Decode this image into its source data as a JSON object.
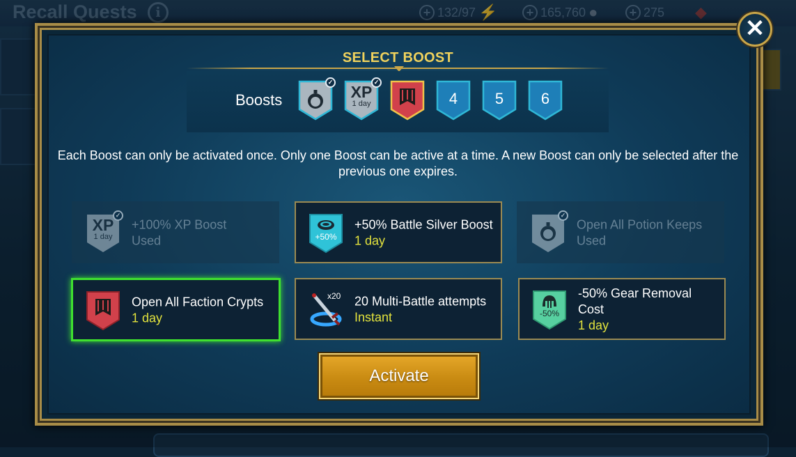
{
  "background": {
    "title": "Recall Quests",
    "info_icon": "i",
    "resources": [
      {
        "icon": "energy-icon",
        "value": "132/97"
      },
      {
        "icon": "silver-icon",
        "value": "165,760"
      },
      {
        "icon": "gem-icon",
        "value": "275"
      }
    ]
  },
  "dialog": {
    "close_glyph": "✕",
    "select_title": "SELECT BOOST",
    "boosts_label": "Boosts",
    "slots": [
      {
        "kind": "potion",
        "used": true
      },
      {
        "kind": "xp",
        "label": "XP",
        "sub": "1 day",
        "used": true
      },
      {
        "kind": "faction",
        "selected": true
      },
      {
        "kind": "empty",
        "label": "4"
      },
      {
        "kind": "empty",
        "label": "5"
      },
      {
        "kind": "empty",
        "label": "6"
      }
    ],
    "description": "Each Boost can only be activated once. Only one Boost can be active at a time. A new Boost can only be selected after the previous one expires.",
    "cards": [
      {
        "name": "+100% XP Boost",
        "sub": "Used",
        "icon_label": "XP",
        "icon_sub": "1 day",
        "state": "used"
      },
      {
        "name": "+50% Battle Silver Boost",
        "sub": "1 day",
        "icon_label": "+50%",
        "state": "available"
      },
      {
        "name": "Open All Potion Keeps",
        "sub": "Used",
        "state": "used"
      },
      {
        "name": "Open All Faction Crypts",
        "sub": "1 day",
        "state": "selected"
      },
      {
        "name": "20 Multi-Battle attempts",
        "sub": "Instant",
        "icon_label": "x20",
        "state": "available"
      },
      {
        "name": "-50% Gear Removal Cost",
        "sub": "1 day",
        "icon_label": "-50%",
        "state": "available"
      }
    ],
    "activate_label": "Activate"
  },
  "colors": {
    "gold": "#c9a649",
    "title_yellow": "#f0d25c",
    "sub_yellow": "#e2e23d",
    "selected_green": "#3fe02f",
    "slot_blue": "#1e7fb8",
    "faction_red": "#d1414b",
    "silver_cyan": "#2fc3d8",
    "gear_green": "#57d0a0"
  }
}
